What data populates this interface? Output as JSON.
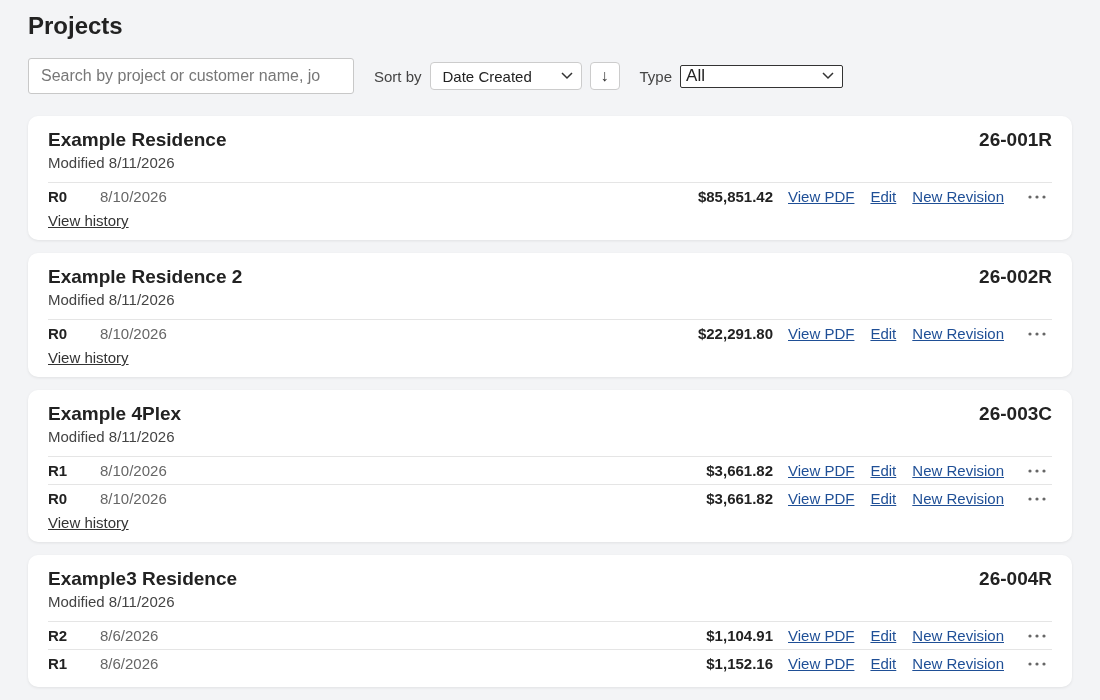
{
  "title": "Projects",
  "search": {
    "placeholder": "Search by project or customer name, jo"
  },
  "sort": {
    "label": "Sort by",
    "value": "Date Created",
    "direction": "↓"
  },
  "type_filter": {
    "label": "Type",
    "value": "All"
  },
  "projects": [
    {
      "name": "Example Residence",
      "modified": "Modified 8/11/2026",
      "number": "26-001R",
      "history": "View history",
      "revisions": [
        {
          "rev": "R0",
          "date": "8/10/2026",
          "amount": "$85,851.42",
          "actions": [
            "View PDF",
            "Edit",
            "New Revision"
          ]
        }
      ]
    },
    {
      "name": "Example Residence 2",
      "modified": "Modified 8/11/2026",
      "number": "26-002R",
      "history": "View history",
      "revisions": [
        {
          "rev": "R0",
          "date": "8/10/2026",
          "amount": "$22,291.80",
          "actions": [
            "View PDF",
            "Edit",
            "New Revision"
          ]
        }
      ]
    },
    {
      "name": "Example 4Plex",
      "modified": "Modified 8/11/2026",
      "number": "26-003C",
      "history": "View history",
      "revisions": [
        {
          "rev": "R1",
          "date": "8/10/2026",
          "amount": "$3,661.82",
          "actions": [
            "View PDF",
            "Edit",
            "New Revision"
          ]
        },
        {
          "rev": "R0",
          "date": "8/10/2026",
          "amount": "$3,661.82",
          "actions": [
            "View PDF",
            "Edit",
            "New Revision"
          ]
        }
      ]
    },
    {
      "name": "Example3 Residence",
      "modified": "Modified 8/11/2026",
      "number": "26-004R",
      "revisions": [
        {
          "rev": "R2",
          "date": "8/6/2026",
          "amount": "$1,104.91",
          "actions": [
            "View PDF",
            "Edit",
            "New Revision"
          ]
        },
        {
          "rev": "R1",
          "date": "8/6/2026",
          "amount": "$1,152.16",
          "actions": [
            "View PDF",
            "Edit",
            "New Revision"
          ]
        }
      ]
    }
  ]
}
